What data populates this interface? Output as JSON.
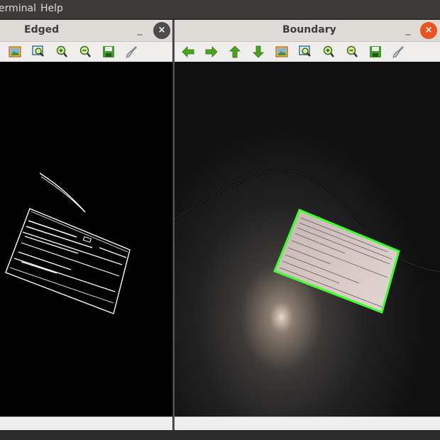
{
  "menubar": {
    "items": [
      "erminal",
      "Help"
    ]
  },
  "windows": {
    "edged": {
      "title": "Edged",
      "min": "_",
      "close": "×"
    },
    "boundary": {
      "title": "Boundary",
      "min": "_",
      "close": "×"
    }
  },
  "toolbar_icons": {
    "edged": [
      "image-icon",
      "zoom-fit-icon",
      "zoom-in-icon",
      "zoom-out-icon",
      "save-icon",
      "brush-icon"
    ],
    "boundary": [
      "arrow-left-icon",
      "arrow-right-icon",
      "arrow-up-icon",
      "arrow-down-icon",
      "image-icon",
      "zoom-fit-icon",
      "zoom-in-icon",
      "zoom-out-icon",
      "save-icon",
      "brush-icon"
    ]
  },
  "colors": {
    "accent_close": "#e95420",
    "detected_contour": "#3bff2a",
    "arrow_green": "#4aa41d"
  }
}
